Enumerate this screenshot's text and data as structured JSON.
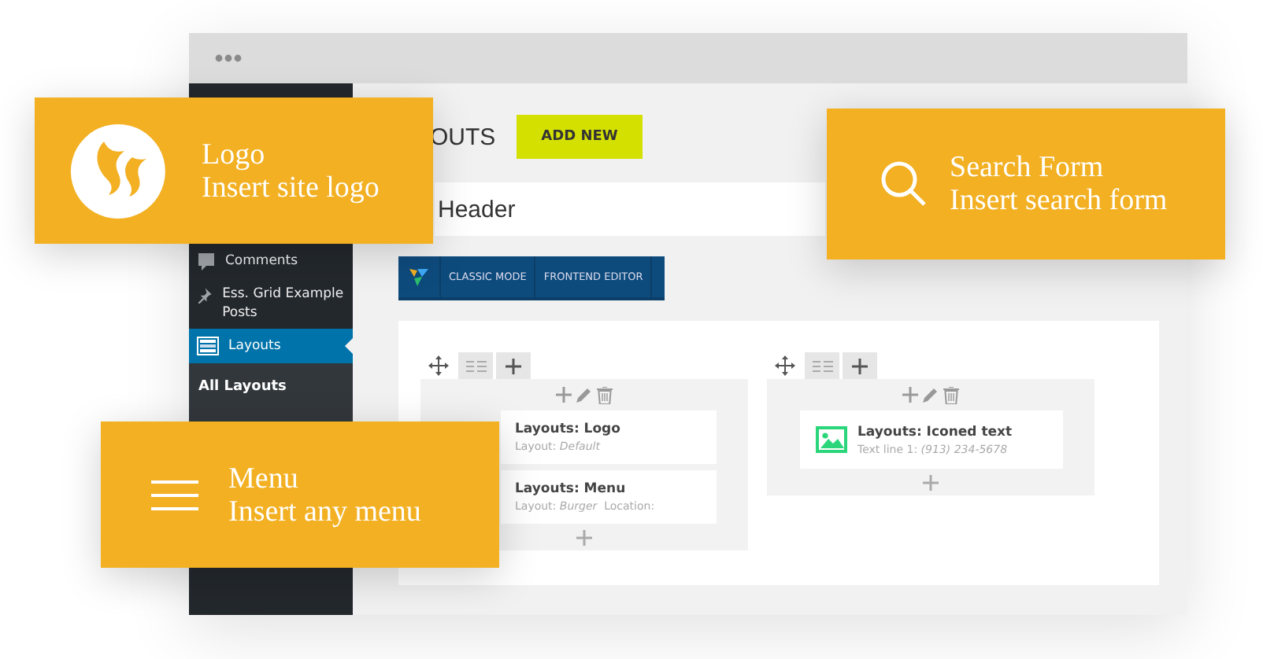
{
  "sidebar": {
    "items": [
      {
        "label": "Comments",
        "kind": "menu",
        "selected": false
      },
      {
        "label": "Ess. Grid Example Posts",
        "kind": "menu",
        "selected": false
      },
      {
        "label": "Layouts",
        "kind": "menu",
        "selected": true
      },
      {
        "label": "All Layouts",
        "kind": "submenu",
        "selected": true
      }
    ]
  },
  "page": {
    "title": "OUTS",
    "add_button": "ADD NEW",
    "title_field": {
      "value": "Header"
    }
  },
  "builder": {
    "toolbar": [
      "CLASSIC MODE",
      "FRONTEND EDITOR"
    ],
    "columns": [
      {
        "elements": [
          {
            "title": "Layouts: Logo",
            "detail": "Layout: *Default*",
            "kind": "plain"
          },
          {
            "title": "Layouts: Menu",
            "detail": "Layout: *Burger*  Location:",
            "kind": "plain"
          }
        ]
      },
      {
        "elements": [
          {
            "title": "Layouts: Iconed text",
            "detail": "Text line 1: *(913) 234-5678*",
            "kind": "image"
          }
        ]
      }
    ]
  },
  "callouts": [
    {
      "kind": "logo",
      "title": "Logo",
      "subtitle": "Insert site logo"
    },
    {
      "kind": "search",
      "title": "Search Form",
      "subtitle": "Insert search form"
    },
    {
      "kind": "menu",
      "title": "Menu",
      "subtitle": "Insert any menu"
    }
  ]
}
